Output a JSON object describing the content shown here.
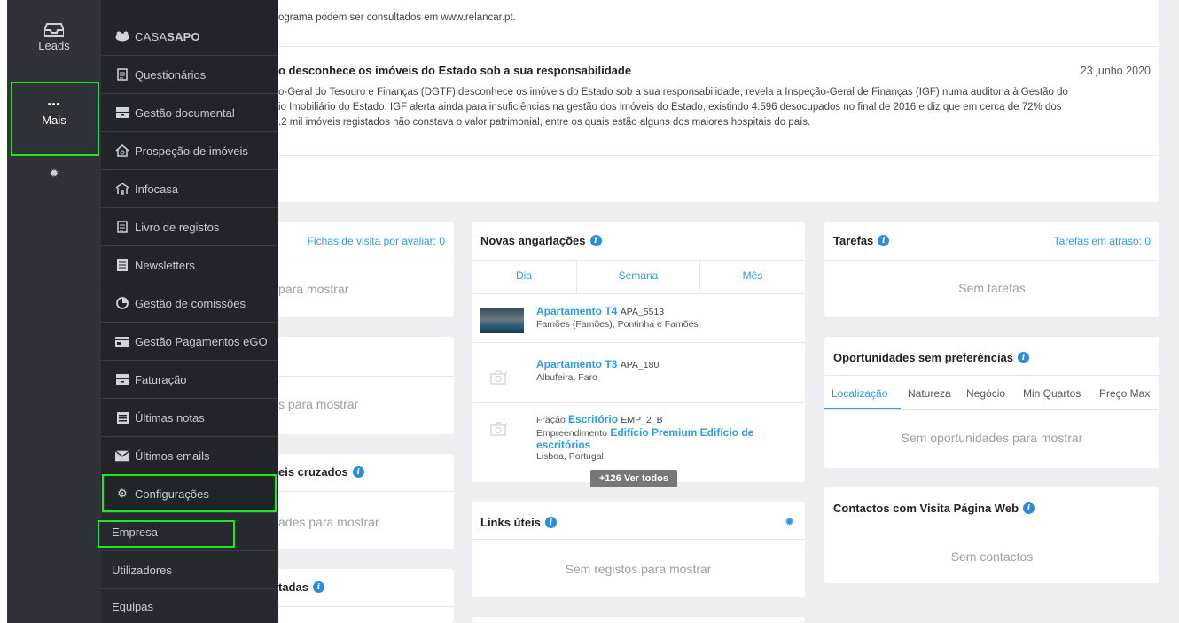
{
  "rail": {
    "leads_label": "Leads",
    "mais_label": "Mais",
    "mais_dots": "•••",
    "gear_icon": "gear-icon"
  },
  "menu": {
    "brand_prefix": "CASA",
    "brand_suffix": "SAPO",
    "items": [
      {
        "label": "Questionários",
        "icon": "document-icon"
      },
      {
        "label": "Gestão documental",
        "icon": "drawer-icon"
      },
      {
        "label": "Prospeção de imóveis",
        "icon": "house-search-icon"
      },
      {
        "label": "Infocasa",
        "icon": "house-icon"
      },
      {
        "label": "Livro de registos",
        "icon": "document-icon"
      },
      {
        "label": "Newsletters",
        "icon": "newspaper-icon"
      },
      {
        "label": "Gestão de comissões",
        "icon": "pie-chart-icon"
      },
      {
        "label": "Gestão Pagamentos eGO",
        "icon": "card-icon"
      },
      {
        "label": "Faturação",
        "icon": "drawer-icon"
      },
      {
        "label": "Últimas notas",
        "icon": "calendar-icon"
      },
      {
        "label": "Últimos emails",
        "icon": "mail-icon"
      },
      {
        "label": "Configurações",
        "icon": "gears-icon"
      }
    ],
    "sub_items": [
      "Empresa",
      "Utilizadores",
      "Equipas"
    ]
  },
  "news": {
    "top_text": "ograma podem ser consultados em www.relancar.pt.",
    "title": "o desconhece os imóveis do Estado sob a sua responsabilidade",
    "date": "23 junho 2020",
    "body_line1": "o-Geral do Tesouro e Finanças (DGTF) desconhece os imóveis do Estado sob a sua responsabilidade, revela a Inspeção-Geral de Finanças (IGF) numa auditoria à Gestão do",
    "body_line2": "io Imobiliário do Estado. IGF alerta ainda para insuficiências na gestão dos imóveis do Estado, existindo 4.596 desocupados no  final de 2016 e diz que em cerca de 72% dos",
    "body_line3": ".2 mil imóveis registados não constava o valor patrimonial, entre os quais estão alguns dos maiores hospitais do país."
  },
  "col1": {
    "visit_link": "Fichas de visita por avaliar: 0",
    "empty1": "para mostrar",
    "empty2": "s para mostrar",
    "cross_title": "eis cruzados",
    "empty3": "ades para mostrar",
    "last_title": "tadas"
  },
  "angariacoes": {
    "title": "Novas angariações",
    "tabs": [
      "Dia",
      "Semana",
      "Mês"
    ],
    "items": [
      {
        "prefix": "",
        "type": "Apartamento T4",
        "code": "APA_5513",
        "location": "Famões (Famões), Pontinha e Famões"
      },
      {
        "prefix": "",
        "type": "Apartamento T3",
        "code": "APA_180",
        "location": "Albufeira, Faro"
      },
      {
        "prefix": "Fração",
        "type": "Escritório",
        "code": "EMP_2_B",
        "dev_prefix": "Empreendimento",
        "dev_name_line1": "Edifício Premium Edifício de",
        "dev_name_line2": "escritórios",
        "location": "Lisboa, Portugal"
      }
    ],
    "more_badge": "+126 Ver todos"
  },
  "links": {
    "title": "Links úteis",
    "empty": "Sem registos para mostrar"
  },
  "tarefas": {
    "title": "Tarefas",
    "link": "Tarefas em atraso: 0",
    "empty": "Sem tarefas"
  },
  "oportunidades": {
    "title": "Oportunidades sem preferências",
    "tabs": [
      "Localização",
      "Natureza",
      "Negócio",
      "Min Quartos",
      "Preço Max"
    ],
    "empty": "Sem oportunidades para mostrar"
  },
  "contactos": {
    "title": "Contactos com Visita Página Web",
    "empty": "Sem contactos"
  },
  "colors": {
    "highlight": "#1ee81e",
    "accent": "#2f9be6",
    "rail_bg": "#2f3338",
    "menu_bg": "#212529"
  }
}
